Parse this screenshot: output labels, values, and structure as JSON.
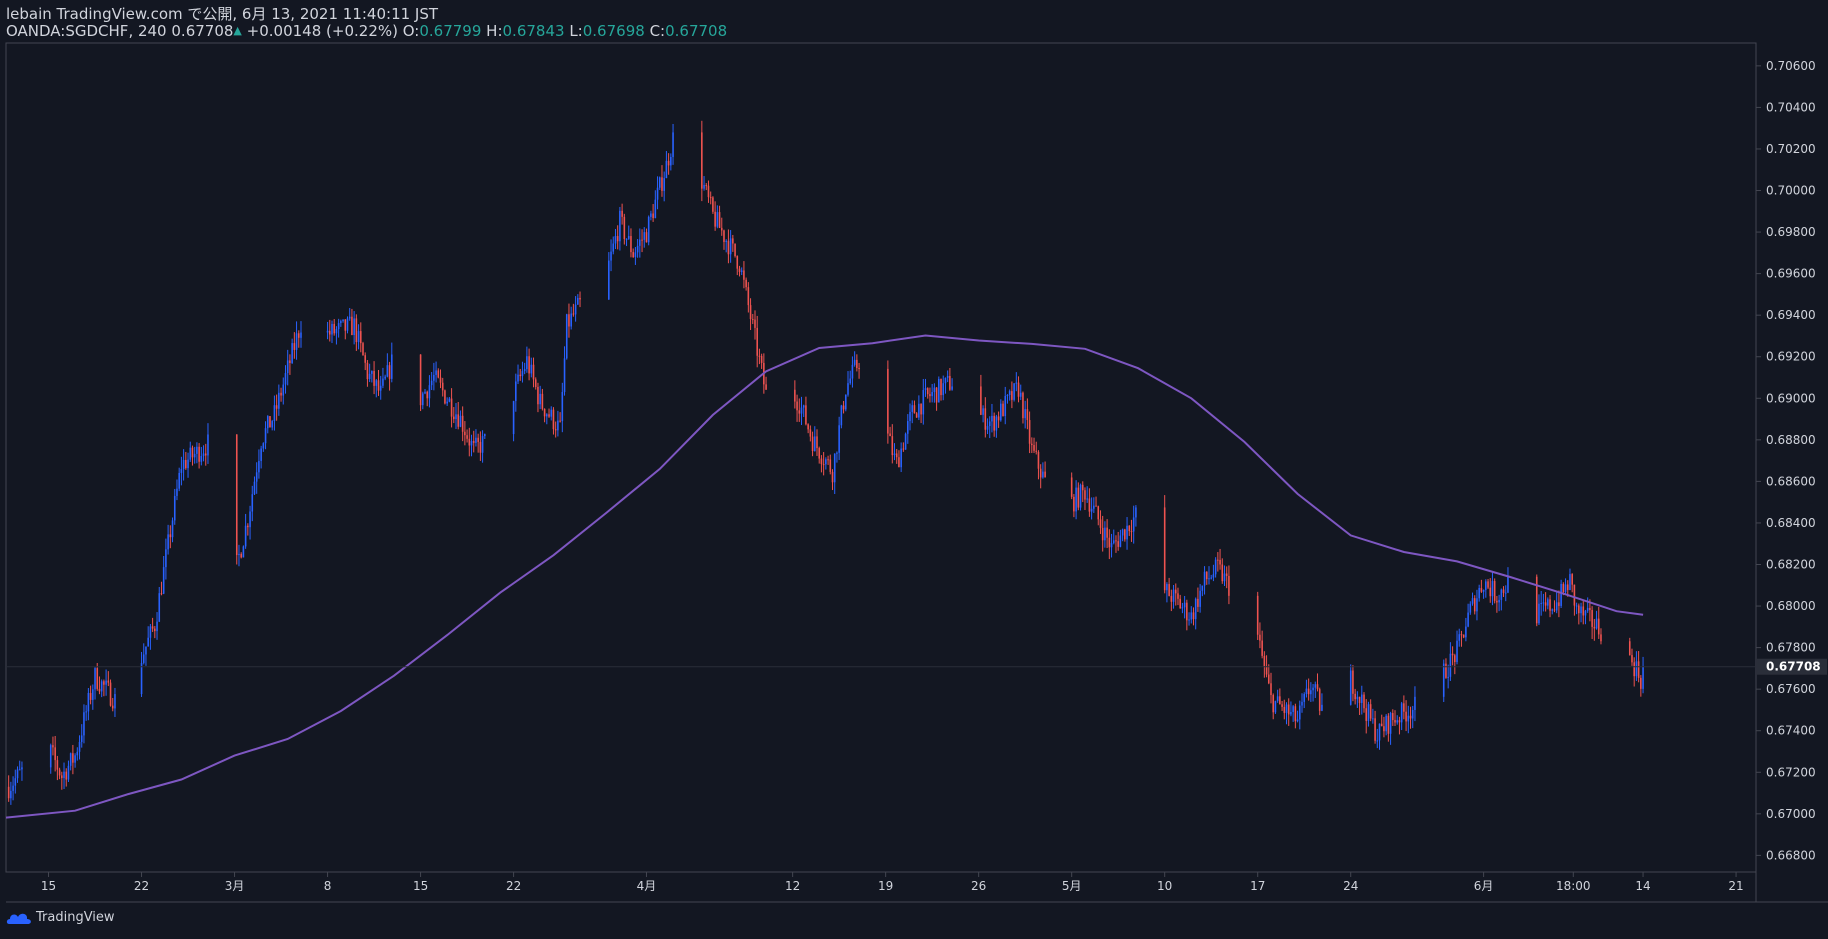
{
  "header": {
    "line1": "lebain TradingView.com で公開, 6月 13, 2021 11:40:11 JST",
    "symbol": "OANDA:SGDCHF, 240",
    "last": "0.67708",
    "arrow": "▲",
    "change": "+0.00148 (+0.22%)",
    "o_label": "O:",
    "o": "0.67799",
    "h_label": "H:",
    "h": "0.67843",
    "l_label": "L:",
    "l": "0.67698",
    "c_label": "C:",
    "c": "0.67708"
  },
  "footer": {
    "brand": "TradingView",
    "logo_icon": "tradingview-cloud-icon"
  },
  "colors": {
    "bg": "#131722",
    "up": "#2962ff",
    "down": "#ef5350",
    "ma": "#7e57c2",
    "grid_text": "#d1d4dc",
    "border": "#434651"
  },
  "chart_data": {
    "type": "candlestick",
    "symbol": "OANDA:SGDCHF",
    "interval": "240",
    "y_ticks": [
      "0.70600",
      "0.70400",
      "0.70200",
      "0.70000",
      "0.69800",
      "0.69600",
      "0.69400",
      "0.69200",
      "0.69000",
      "0.68800",
      "0.68600",
      "0.68400",
      "0.68200",
      "0.68000",
      "0.67800",
      "0.67600",
      "0.67400",
      "0.67200",
      "0.67000",
      "0.66800"
    ],
    "ylim": [
      0.6672,
      0.7071
    ],
    "last_price_label": "0.67708",
    "x_ticks": [
      "15",
      "22",
      "3月",
      "8",
      "15",
      "22",
      "4月",
      "12",
      "19",
      "26",
      "5月",
      "10",
      "17",
      "24",
      "6月",
      "18:00",
      "14",
      "21"
    ],
    "x_tick_days": [
      0,
      7,
      14,
      21,
      28,
      35,
      45,
      56,
      63,
      70,
      77,
      84,
      91,
      98,
      108,
      114.75,
      120,
      127
    ],
    "x_days_range": [
      -3.2,
      128.5
    ],
    "close_path_days": [
      -3.0,
      -1.5,
      0,
      1,
      2,
      3.5,
      5,
      6,
      8,
      10,
      12,
      14,
      15,
      16,
      17,
      19,
      20,
      21,
      23,
      24,
      25,
      26,
      27,
      28,
      29,
      31,
      32,
      33,
      35,
      36,
      37,
      38.5,
      39,
      40,
      42,
      43,
      44,
      45,
      46.5,
      47,
      48,
      49,
      50,
      52,
      53,
      54,
      55,
      56,
      56.5,
      57.5,
      59,
      60,
      61,
      62,
      63,
      63.8,
      65,
      66,
      68,
      70,
      71,
      73,
      74,
      75,
      76,
      77,
      78,
      80,
      82,
      83.5,
      84.5,
      86,
      87,
      88,
      90,
      91,
      91.5,
      92,
      94,
      95,
      96,
      97.5,
      98,
      99,
      100,
      101,
      103,
      104,
      105,
      106,
      107,
      108,
      109,
      110,
      111,
      112,
      113.5,
      114.5,
      115,
      116,
      117.5,
      118.5,
      119.5,
      120
    ],
    "close_path_values": [
      0.6713,
      0.6724,
      0.6732,
      0.6718,
      0.6728,
      0.6766,
      0.6755,
      0.676,
      0.6791,
      0.6868,
      0.6878,
      0.6815,
      0.6842,
      0.688,
      0.6892,
      0.6936,
      0.6952,
      0.6931,
      0.6935,
      0.6912,
      0.6902,
      0.692,
      0.6908,
      0.69,
      0.691,
      0.689,
      0.6875,
      0.688,
      0.6902,
      0.6918,
      0.6898,
      0.6885,
      0.6935,
      0.6945,
      0.696,
      0.6985,
      0.697,
      0.698,
      0.7012,
      0.7025,
      0.7005,
      0.7008,
      0.6988,
      0.6965,
      0.6934,
      0.6902,
      0.6915,
      0.6902,
      0.6898,
      0.688,
      0.6865,
      0.6905,
      0.6918,
      0.6898,
      0.6885,
      0.6868,
      0.6893,
      0.69,
      0.6908,
      0.6892,
      0.6888,
      0.6905,
      0.6875,
      0.686,
      0.6858,
      0.685,
      0.6855,
      0.6828,
      0.6845,
      0.681,
      0.6805,
      0.6795,
      0.6812,
      0.6818,
      0.6798,
      0.6785,
      0.677,
      0.6755,
      0.6745,
      0.6762,
      0.6748,
      0.6772,
      0.6765,
      0.6752,
      0.6738,
      0.6745,
      0.6752,
      0.6758,
      0.6768,
      0.6778,
      0.6798,
      0.6812,
      0.6805,
      0.6812,
      0.6788,
      0.6796,
      0.6802,
      0.6812,
      0.6798,
      0.6793,
      0.6785,
      0.6778,
      0.677,
      0.6762,
      0.6758,
      0.6771
    ],
    "ma_days": [
      -3.2,
      2,
      6,
      10,
      14,
      18,
      22,
      26,
      30,
      34,
      38,
      42,
      46,
      50,
      54,
      58,
      62,
      66,
      70,
      74,
      78,
      82,
      86,
      90,
      94,
      98,
      102,
      106,
      110,
      114,
      118,
      120
    ],
    "ma_values": [
      0.66982,
      0.67015,
      0.67095,
      0.67165,
      0.6728,
      0.6736,
      0.67495,
      0.67665,
      0.6786,
      0.68065,
      0.68245,
      0.6845,
      0.6866,
      0.6892,
      0.6913,
      0.69242,
      0.69265,
      0.69302,
      0.69278,
      0.69262,
      0.69238,
      0.69145,
      0.69,
      0.6879,
      0.6854,
      0.6834,
      0.6826,
      0.68215,
      0.6814,
      0.6806,
      0.67975,
      0.67958
    ]
  }
}
